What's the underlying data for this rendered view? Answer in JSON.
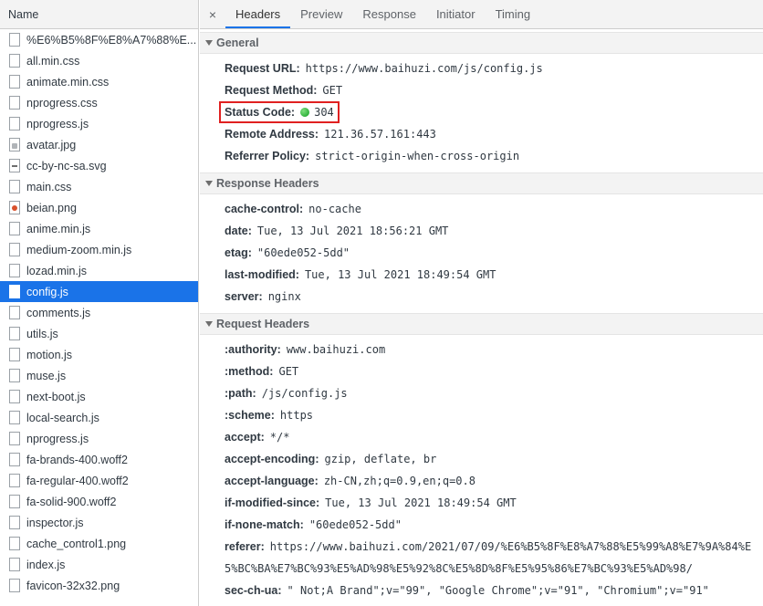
{
  "left_panel": {
    "header": "Name",
    "files": [
      {
        "name": "%E6%B5%8F%E8%A7%88%E...",
        "icon": "document-icon"
      },
      {
        "name": "all.min.css",
        "icon": "document-icon"
      },
      {
        "name": "animate.min.css",
        "icon": "document-icon"
      },
      {
        "name": "nprogress.css",
        "icon": "document-icon"
      },
      {
        "name": "nprogress.js",
        "icon": "document-icon"
      },
      {
        "name": "avatar.jpg",
        "icon": "image-icon"
      },
      {
        "name": "cc-by-nc-sa.svg",
        "icon": "svg-icon"
      },
      {
        "name": "main.css",
        "icon": "document-icon"
      },
      {
        "name": "beian.png",
        "icon": "image-icon"
      },
      {
        "name": "anime.min.js",
        "icon": "document-icon"
      },
      {
        "name": "medium-zoom.min.js",
        "icon": "document-icon"
      },
      {
        "name": "lozad.min.js",
        "icon": "document-icon"
      },
      {
        "name": "config.js",
        "icon": "document-icon",
        "selected": true
      },
      {
        "name": "comments.js",
        "icon": "document-icon"
      },
      {
        "name": "utils.js",
        "icon": "document-icon"
      },
      {
        "name": "motion.js",
        "icon": "document-icon"
      },
      {
        "name": "muse.js",
        "icon": "document-icon"
      },
      {
        "name": "next-boot.js",
        "icon": "document-icon"
      },
      {
        "name": "local-search.js",
        "icon": "document-icon"
      },
      {
        "name": "nprogress.js",
        "icon": "document-icon"
      },
      {
        "name": "fa-brands-400.woff2",
        "icon": "document-icon"
      },
      {
        "name": "fa-regular-400.woff2",
        "icon": "document-icon"
      },
      {
        "name": "fa-solid-900.woff2",
        "icon": "document-icon"
      },
      {
        "name": "inspector.js",
        "icon": "document-icon"
      },
      {
        "name": "cache_control1.png",
        "icon": "document-icon"
      },
      {
        "name": "index.js",
        "icon": "document-icon"
      },
      {
        "name": "favicon-32x32.png",
        "icon": "document-icon"
      }
    ]
  },
  "tabs": {
    "close": "×",
    "items": [
      "Headers",
      "Preview",
      "Response",
      "Initiator",
      "Timing"
    ],
    "active": "Headers"
  },
  "general": {
    "title": "General",
    "request_url_key": "Request URL:",
    "request_url": "https://www.baihuzi.com/js/config.js",
    "request_method_key": "Request Method:",
    "request_method": "GET",
    "status_code_key": "Status Code:",
    "status_code": "304",
    "status_color": "#1aa13a",
    "remote_address_key": "Remote Address:",
    "remote_address": "121.36.57.161:443",
    "referrer_policy_key": "Referrer Policy:",
    "referrer_policy": "strict-origin-when-cross-origin"
  },
  "response_headers": {
    "title": "Response Headers",
    "items": [
      {
        "key": "cache-control:",
        "value": "no-cache"
      },
      {
        "key": "date:",
        "value": "Tue, 13 Jul 2021 18:56:21 GMT"
      },
      {
        "key": "etag:",
        "value": "\"60ede052-5dd\""
      },
      {
        "key": "last-modified:",
        "value": "Tue, 13 Jul 2021 18:49:54 GMT"
      },
      {
        "key": "server:",
        "value": "nginx"
      }
    ]
  },
  "request_headers": {
    "title": "Request Headers",
    "items": [
      {
        "key": ":authority:",
        "value": "www.baihuzi.com"
      },
      {
        "key": ":method:",
        "value": "GET"
      },
      {
        "key": ":path:",
        "value": "/js/config.js"
      },
      {
        "key": ":scheme:",
        "value": "https"
      },
      {
        "key": "accept:",
        "value": "*/*"
      },
      {
        "key": "accept-encoding:",
        "value": "gzip, deflate, br"
      },
      {
        "key": "accept-language:",
        "value": "zh-CN,zh;q=0.9,en;q=0.8"
      },
      {
        "key": "if-modified-since:",
        "value": "Tue, 13 Jul 2021 18:49:54 GMT"
      },
      {
        "key": "if-none-match:",
        "value": "\"60ede052-5dd\""
      },
      {
        "key": "referer:",
        "value": "https://www.baihuzi.com/2021/07/09/%E6%B5%8F%E8%A7%88%E5%99%A8%E7%9A%84%E"
      },
      {
        "key": "",
        "value": "5%BC%BA%E7%BC%93%E5%AD%98%E5%92%8C%E5%8D%8F%E5%95%86%E7%BC%93%E5%AD%98/",
        "continuation": true
      },
      {
        "key": "sec-ch-ua:",
        "value": "\" Not;A Brand\";v=\"99\", \"Google Chrome\";v=\"91\", \"Chromium\";v=\"91\""
      }
    ]
  }
}
